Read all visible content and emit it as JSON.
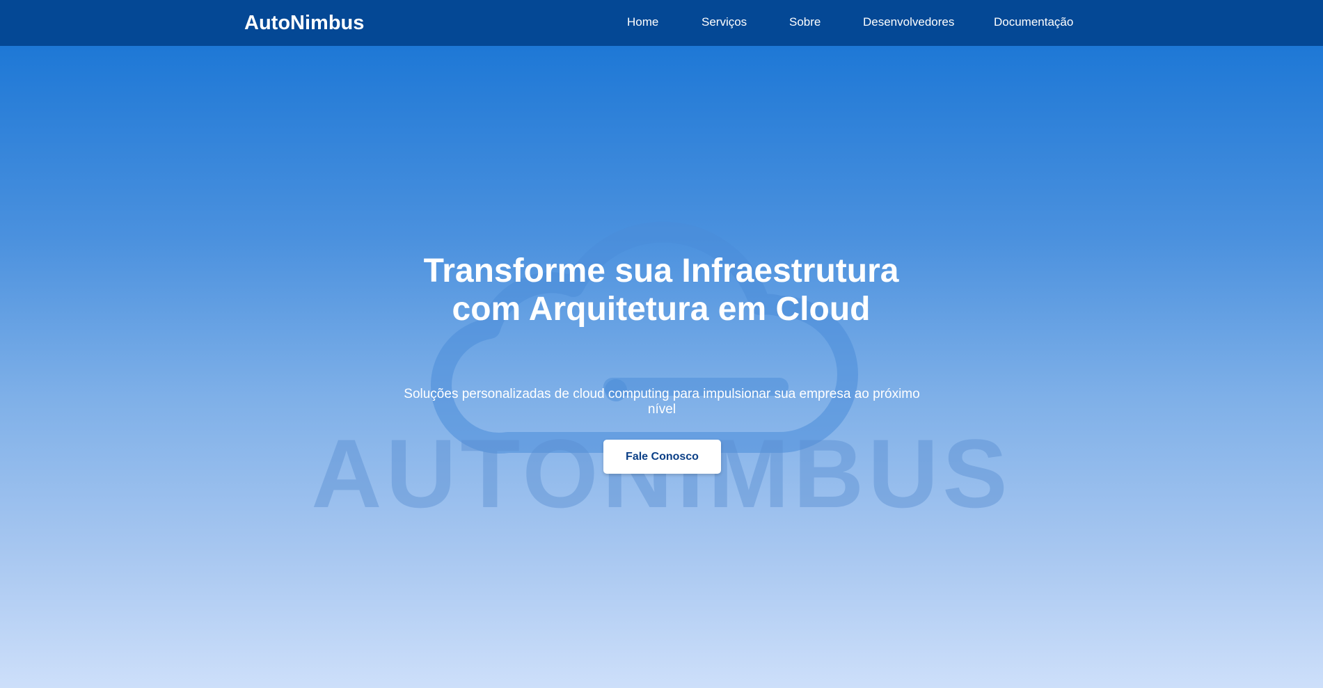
{
  "header": {
    "brand": "AutoNimbus",
    "nav": [
      {
        "label": "Home"
      },
      {
        "label": "Serviços"
      },
      {
        "label": "Sobre"
      },
      {
        "label": "Desenvolvedores"
      },
      {
        "label": "Documentação"
      }
    ]
  },
  "hero": {
    "title_line1": "Transforme sua Infraestrutura",
    "title_line2": "com Arquitetura em Cloud",
    "subtitle": "Soluções personalizadas de cloud computing para impulsionar sua empresa ao próximo nível",
    "cta_label": "Fale Conosco",
    "watermark_text": "AUTONIMBUS"
  },
  "colors": {
    "navbar": "#044895",
    "gradient_top": "#1e78d6",
    "gradient_bottom": "#cddffa",
    "cta_text": "#0b3f86"
  }
}
